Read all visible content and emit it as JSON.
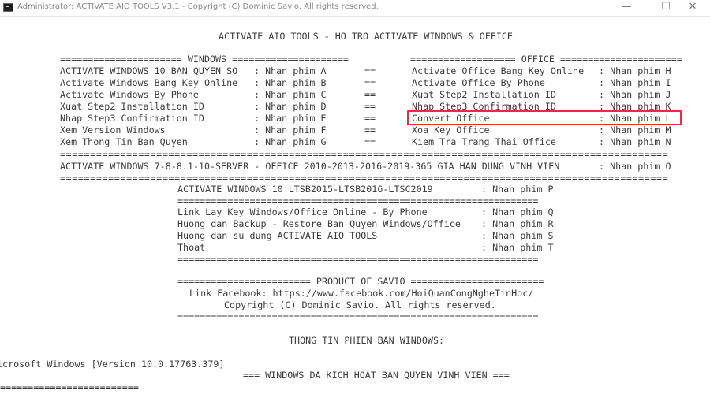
{
  "window": {
    "title": "Administrator:  ACTIVATE AIO TOOLS V3.1 - Copyright (C) Dominic Savio. All rights reserved.",
    "minimize_glyph": "—",
    "maximize_glyph": "☐",
    "close_glyph": "✕"
  },
  "console": {
    "header": "ACTIVATE AIO TOOLS - HO TRO ACTIVATE WINDOWS & OFFICE",
    "windows_rule": "====================== WINDOWS =====================",
    "office_rule": "=================== OFFICE ======================",
    "windows_menu": [
      {
        "label": "ACTIVATE WINDOWS 10 BAN QUYEN SO",
        "key": ": Nhan phim A"
      },
      {
        "label": "Activate Windows Bang Key Online",
        "key": ": Nhan phim B"
      },
      {
        "label": "Activate Windows By Phone",
        "key": ": Nhan phim C"
      },
      {
        "label": "Xuat Step2 Installation ID",
        "key": ": Nhan phim D"
      },
      {
        "label": "Nhap Step3 Confirmation ID",
        "key": ": Nhan phim E"
      },
      {
        "label": "Xem Version Windows",
        "key": ": Nhan phim F"
      },
      {
        "label": "Xem Thong Tin Ban Quyen",
        "key": ": Nhan phim G"
      }
    ],
    "separator": "==",
    "office_menu": [
      {
        "label": "Activate Office Bang Key Online",
        "key": ": Nhan phim H"
      },
      {
        "label": "Activate Office By Phone",
        "key": ": Nhan phim I"
      },
      {
        "label": "Xuat Step2 Installation ID",
        "key": ": Nhan phim J"
      },
      {
        "label": "Nhap Step3 Confirmation ID",
        "key": ": Nhan phim K"
      },
      {
        "label": "Convert Office",
        "key": ": Nhan phim L"
      },
      {
        "label": "Xoa Key Office",
        "key": ": Nhan phim M"
      },
      {
        "label": "Kiem Tra Trang Thai Office",
        "key": ": Nhan phim N"
      }
    ],
    "full_rule": "=====================================================================================================",
    "permanent_label": "ACTIVATE WINDOWS 7-8-8.1-10-SERVER - OFFICE 2010-2013-2016-2019-365 GIA HAN DUNG VINH VIEN",
    "permanent_key": ": Nhan phim O",
    "mid_rule": "=================================================================",
    "ltsb_label": "ACTIVATE WINDOWS 10 LTSB2015-LTSB2016-LTSC2019",
    "ltsb_key": ": Nhan phim P",
    "extra_menu": [
      {
        "label": "Link Lay Key Windows/Office Online - By Phone",
        "key": ": Nhan phim Q"
      },
      {
        "label": "Huong dan Backup - Restore Ban Quyen Windows/Office",
        "key": ": Nhan phim R"
      },
      {
        "label": "Huong dan su dung ACTIVATE AIO TOOLS",
        "key": ": Nhan phim S"
      },
      {
        "label": "Thoat",
        "key": ": Nhan phim T"
      }
    ],
    "product_line": "======================== PRODUCT OF SAVIO ========================",
    "facebook_line": "Link Facebook: https://www.facebook.com/HoiQuanCongNgheTinHoc/",
    "copyright_line": "Copyright (C) Dominic Savio. All rights reserved.",
    "info_title": "THONG TIN PHIEN BAN WINDOWS:",
    "version_line": "icrosoft Windows [Version 10.0.17763.379]",
    "activated_line": "=== WINDOWS DA KICH HOAT BAN QUYEN VINH VIEN ===",
    "bottom_rule": "========================="
  },
  "highlight": {
    "item": "Convert Office",
    "color": "#e0303a"
  }
}
